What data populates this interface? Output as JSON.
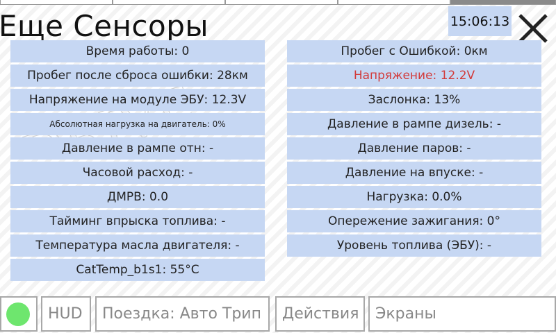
{
  "header": {
    "title": "Еще Сенсоры",
    "clock": "15:06:13"
  },
  "watermark": {
    "text": "DRIVE"
  },
  "left_sensors": [
    "Время работы: 0",
    "Пробег после сброса ошибки: 28км",
    "Напряжение на модуле ЭБУ: 12.3V",
    "Абсолютная нагрузка на двигатель: 0%",
    "Давление в рампе отн: -",
    "Часовой расход: -",
    "ДМРВ: 0.0",
    "Тайминг впрыска топлива: -",
    "Температура масла двигателя: -",
    "CatTemp_b1s1: 55°C"
  ],
  "right_sensors": [
    "Пробег с Ошибкой: 0км",
    "Напряжение: 12.2V",
    "Заслонка: 13%",
    "Давление в рампе дизель: -",
    "Давление паров: -",
    "Давление на впуске: -",
    "Нагрузка: 0.0%",
    "Опережение зажигания: 0°",
    "Уровень топлива (ЭБУ): -"
  ],
  "bottom_bar": {
    "hud": "HUD",
    "trip": "Поездка: Авто Трип",
    "actions": "Действия",
    "screens": "Экраны"
  },
  "colors": {
    "row_bg": "#c6d7f3",
    "alert_text": "#d23a3a",
    "status_indicator": "#6ee66e"
  }
}
